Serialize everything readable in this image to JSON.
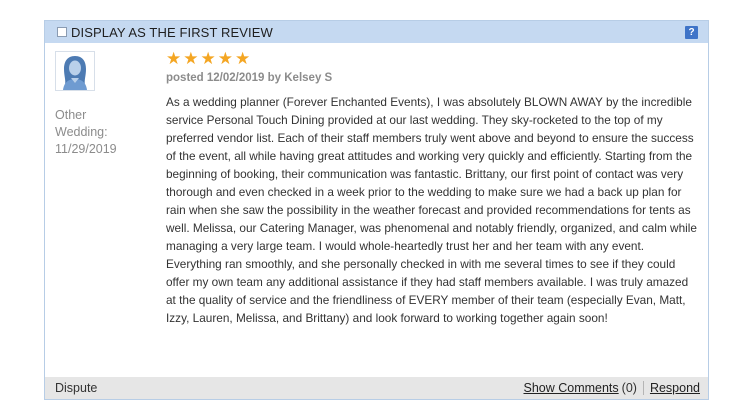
{
  "header": {
    "checkbox_label": "DISPLAY AS THE FIRST REVIEW",
    "help_symbol": "?"
  },
  "reviewer": {
    "type": "Other",
    "event_label": "Wedding:",
    "event_date": "11/29/2019",
    "avatar_icon": "person-avatar-icon"
  },
  "review": {
    "rating": 5,
    "rating_max": 5,
    "star_color": "#f4a623",
    "posted_line": "posted 12/02/2019 by Kelsey S",
    "text": "As a wedding planner (Forever Enchanted Events), I was absolutely BLOWN AWAY by the incredible service Personal Touch Dining provided at our last wedding. They sky-rocketed to the top of my preferred vendor list. Each of their staff members truly went above and beyond to ensure the success of the event, all while having great attitudes and working very quickly and efficiently. Starting from the beginning of booking, their communication was fantastic. Brittany, our first point of contact was very thorough and even checked in a week prior to the wedding to make sure we had a back up plan for rain when she saw the possibility in the weather forecast and provided recommendations for tents as well. Melissa, our Catering Manager, was phenomenal and notably friendly, organized, and calm while managing a very large team. I would whole-heartedly trust her and her team with any event. Everything ran smoothly, and she personally checked in with me several times to see if they could offer my own team any additional assistance if they had staff members available. I was truly amazed at the quality of service and the friendliness of EVERY member of their team (especially Evan, Matt, Izzy, Lauren, Melissa, and Brittany) and look forward to working together again soon!"
  },
  "footer": {
    "dispute_label": "Dispute",
    "show_comments_label": "Show Comments",
    "comment_count": "(0)",
    "respond_label": "Respond"
  }
}
